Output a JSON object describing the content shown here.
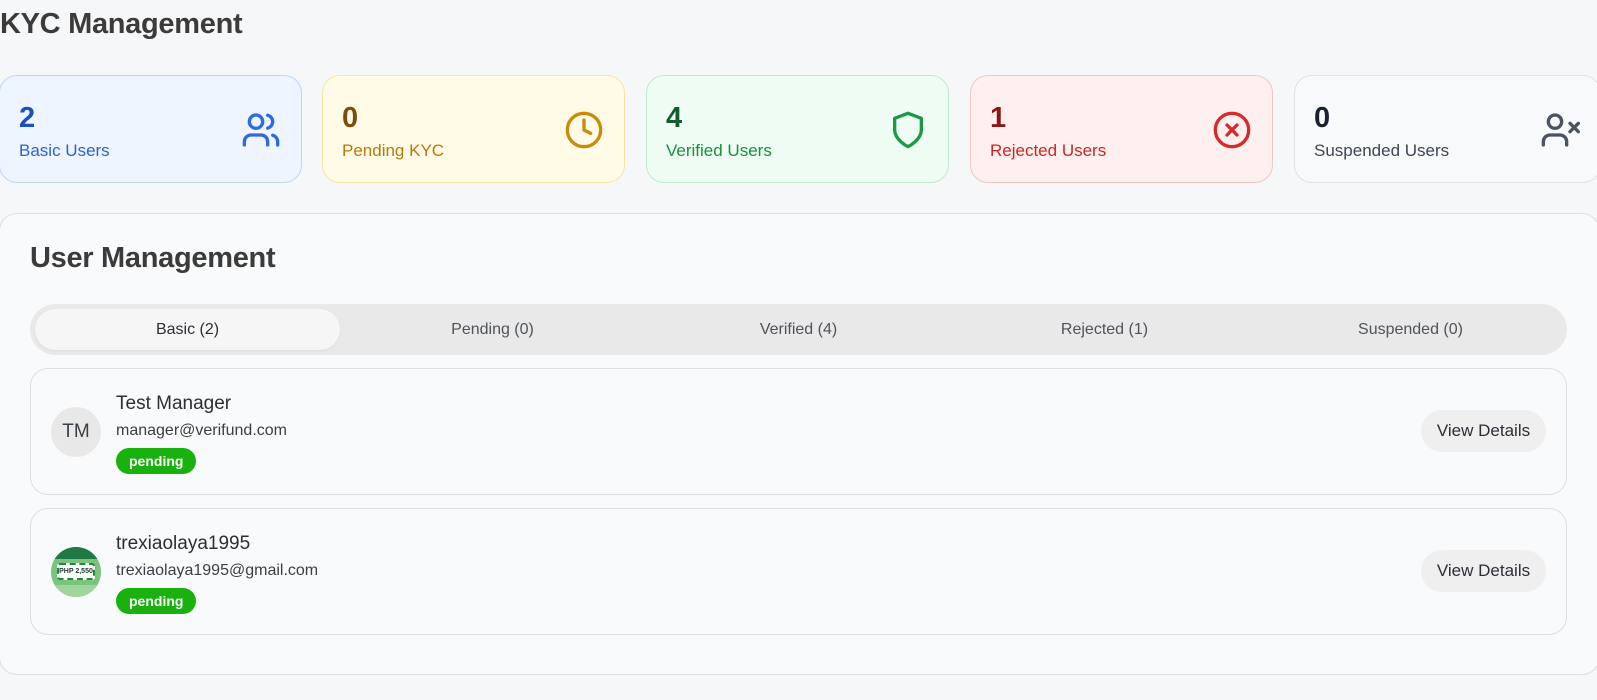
{
  "page": {
    "title": "KYC Management"
  },
  "stats": [
    {
      "value": "2",
      "label": "Basic Users",
      "icon": "users-icon",
      "color": "#2f6ae0"
    },
    {
      "value": "0",
      "label": "Pending KYC",
      "icon": "clock-icon",
      "color": "#c98a0e"
    },
    {
      "value": "4",
      "label": "Verified Users",
      "icon": "shield-icon",
      "color": "#1a9a45"
    },
    {
      "value": "1",
      "label": "Rejected Users",
      "icon": "x-circle-icon",
      "color": "#d62b2b"
    },
    {
      "value": "0",
      "label": "Suspended Users",
      "icon": "user-x-icon",
      "color": "#4a5361"
    }
  ],
  "management": {
    "title": "User Management",
    "tabs": [
      {
        "label": "Basic (2)",
        "active": true
      },
      {
        "label": "Pending (0)",
        "active": false
      },
      {
        "label": "Verified (4)",
        "active": false
      },
      {
        "label": "Rejected (1)",
        "active": false
      },
      {
        "label": "Suspended (0)",
        "active": false
      }
    ],
    "users": [
      {
        "initials": "TM",
        "name": "Test Manager",
        "email": "manager@verifund.com",
        "status": "pending",
        "action": "View Details"
      },
      {
        "avatar_text": "PHP 2,550",
        "name": "trexiaolaya1995",
        "email": "trexiaolaya1995@gmail.com",
        "status": "pending",
        "action": "View Details"
      }
    ]
  },
  "colors": {
    "status_pending": "#18b10e"
  }
}
